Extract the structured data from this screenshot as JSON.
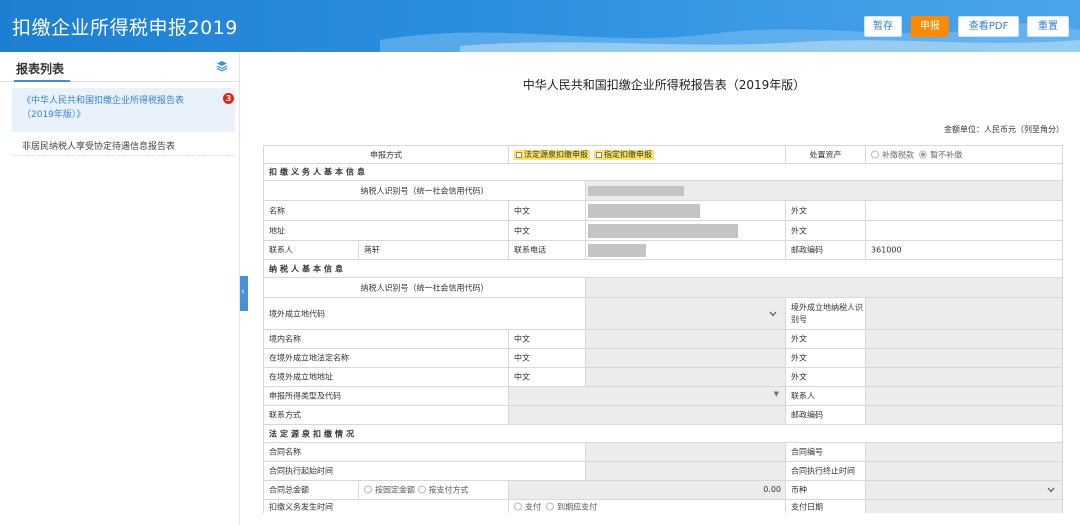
{
  "header": {
    "title": "扣缴企业所得税申报2019",
    "buttons": {
      "save": "暂存",
      "submit": "申报",
      "view_pdf": "查看PDF",
      "reset": "重置"
    }
  },
  "sidebar": {
    "title": "报表列表",
    "items": [
      {
        "label": "《中华人民共和国扣缴企业所得税报告表（2019年版）》",
        "badge": "3"
      },
      {
        "label": "非居民纳税人享受协定待遇信息报告表"
      }
    ]
  },
  "form": {
    "title": "中华人民共和国扣缴企业所得税报告表（2019年版）",
    "unit_note": "金额单位：人民币元（列至角分）",
    "declare_method_label": "申报方式",
    "declare_method_options": [
      "法定源泉扣缴申报",
      "指定扣缴申报"
    ],
    "dispose_assets_label": "处置资产",
    "dispose_assets_options": [
      "补缴税款",
      "暂不补缴"
    ],
    "section1": "扣缴义务人基本信息",
    "taxpayer_id_label": "纳税人识别号（统一社会信用代码）",
    "name_label": "名称",
    "address_label": "地址",
    "chinese_label": "中文",
    "foreign_label": "外文",
    "contact_label": "联系人",
    "contact_value": "蒋轩",
    "phone_label": "联系电话",
    "postcode_label": "邮政编码",
    "postcode_value": "361000",
    "section2": "纳税人基本信息",
    "foreign_place_code_label": "境外成立地代码",
    "foreign_taxpayer_id_label": "境外成立地纳税人识别号",
    "domestic_name_label": "境内名称",
    "foreign_legal_name_label": "在境外成立地法定名称",
    "foreign_address_label": "在境外成立地地址",
    "income_type_label": "申报所得类型及代码",
    "contact_person_label": "联系人",
    "contact_method_label": "联系方式",
    "postcode2_label": "邮政编码",
    "section3": "法定源泉扣缴情况",
    "contract_name_label": "合同名称",
    "contract_no_label": "合同编号",
    "contract_start_label": "合同执行起始时间",
    "contract_end_label": "合同执行终止时间",
    "contract_total_label": "合同总金额",
    "contract_total_options": [
      "按固定金额",
      "按支付方式"
    ],
    "contract_total_value": "0.00",
    "currency_label": "币种",
    "withholding_time_label": "扣缴义务发生时间",
    "withholding_time_options": [
      "支付",
      "到期应支付"
    ],
    "pay_date_label": "支付日期"
  },
  "colors": {
    "header_blue": "#2b8fe0",
    "accent_orange": "#ff8a00",
    "badge_red": "#e2231a",
    "link_blue": "#3a83d3"
  }
}
